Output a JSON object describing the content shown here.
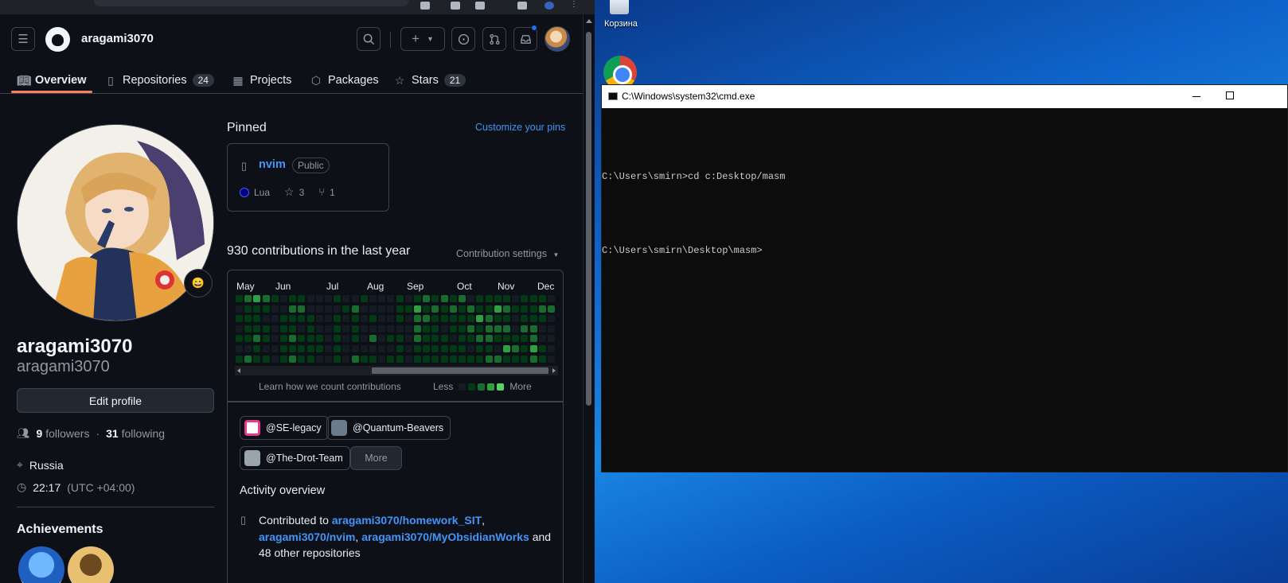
{
  "header": {
    "username": "aragami3070"
  },
  "tabs": [
    {
      "label": "Overview",
      "icon": "book-icon",
      "count": ""
    },
    {
      "label": "Repositories",
      "icon": "repo-icon",
      "count": "24"
    },
    {
      "label": "Projects",
      "icon": "table-icon",
      "count": ""
    },
    {
      "label": "Packages",
      "icon": "package-icon",
      "count": ""
    },
    {
      "label": "Stars",
      "icon": "star-icon",
      "count": "21"
    }
  ],
  "profile": {
    "name": "aragami3070",
    "login": "aragami3070",
    "edit_label": "Edit profile",
    "followers_count": "9",
    "followers_label": "followers",
    "separator": "·",
    "following_count": "31",
    "following_label": "following",
    "location": "Russia",
    "time": "22:17",
    "timezone": "(UTC +04:00)",
    "achievements_title": "Achievements",
    "status_emoji": "😄"
  },
  "pinned": {
    "title": "Pinned",
    "customize_label": "Customize your pins",
    "repo_name": "nvim",
    "visibility": "Public",
    "language": "Lua",
    "stars": "3",
    "forks": "1"
  },
  "contributions": {
    "title": "930 contributions in the last year",
    "settings_label": "Contribution settings",
    "months": [
      "May",
      "Jun",
      "Jul",
      "Aug",
      "Sep",
      "Oct",
      "Nov",
      "Dec"
    ],
    "learn_label": "Learn how we count contributions",
    "less_label": "Less",
    "more_label": "More",
    "levels_colors": [
      "#151b23",
      "#033a16",
      "#196c2e",
      "#2ea043",
      "#56d364"
    ],
    "weeks": [
      [
        1,
        0,
        1,
        0,
        1,
        0,
        1
      ],
      [
        2,
        1,
        1,
        1,
        1,
        0,
        2
      ],
      [
        3,
        1,
        1,
        1,
        2,
        1,
        1
      ],
      [
        2,
        1,
        0,
        1,
        1,
        0,
        1
      ],
      [
        1,
        0,
        0,
        0,
        0,
        0,
        0
      ],
      [
        0,
        0,
        1,
        1,
        1,
        1,
        1
      ],
      [
        1,
        2,
        1,
        1,
        2,
        1,
        2
      ],
      [
        1,
        2,
        1,
        0,
        1,
        1,
        1
      ],
      [
        0,
        0,
        1,
        1,
        1,
        1,
        1
      ],
      [
        0,
        0,
        0,
        0,
        1,
        1,
        0
      ],
      [
        0,
        0,
        0,
        0,
        0,
        0,
        0
      ],
      [
        1,
        0,
        1,
        1,
        1,
        1,
        1
      ],
      [
        0,
        1,
        0,
        0,
        0,
        0,
        0
      ],
      [
        0,
        2,
        1,
        1,
        1,
        0,
        2
      ],
      [
        1,
        0,
        0,
        0,
        0,
        0,
        1
      ],
      [
        0,
        0,
        1,
        0,
        2,
        0,
        1
      ],
      [
        0,
        0,
        0,
        0,
        0,
        0,
        0
      ],
      [
        0,
        0,
        0,
        0,
        1,
        0,
        1
      ],
      [
        1,
        1,
        1,
        0,
        1,
        1,
        1
      ],
      [
        0,
        1,
        0,
        0,
        0,
        0,
        0
      ],
      [
        1,
        3,
        2,
        2,
        2,
        1,
        1
      ],
      [
        2,
        1,
        2,
        1,
        1,
        1,
        1
      ],
      [
        1,
        2,
        1,
        1,
        1,
        1,
        1
      ],
      [
        2,
        1,
        1,
        0,
        1,
        1,
        1
      ],
      [
        1,
        2,
        1,
        1,
        0,
        1,
        1
      ],
      [
        2,
        1,
        1,
        1,
        1,
        1,
        1
      ],
      [
        0,
        2,
        1,
        2,
        1,
        0,
        1
      ],
      [
        1,
        1,
        3,
        1,
        2,
        1,
        1
      ],
      [
        1,
        1,
        2,
        2,
        2,
        1,
        2
      ],
      [
        1,
        3,
        1,
        2,
        1,
        0,
        2
      ],
      [
        1,
        2,
        1,
        2,
        1,
        3,
        1
      ],
      [
        0,
        1,
        0,
        0,
        1,
        2,
        1
      ],
      [
        1,
        1,
        1,
        2,
        1,
        1,
        1
      ],
      [
        1,
        1,
        1,
        2,
        2,
        3,
        2
      ],
      [
        1,
        2,
        1,
        0,
        0,
        1,
        1
      ],
      [
        0,
        2,
        0,
        0,
        0,
        0,
        0
      ]
    ]
  },
  "orgs": [
    {
      "name": "@SE-legacy",
      "color": "#e9398a"
    },
    {
      "name": "@Quantum-Beavers",
      "color": "#6b7b8c"
    },
    {
      "name": "@The-Drot-Team",
      "color": "#9aa4ae"
    }
  ],
  "orgs_more_label": "More",
  "activity": {
    "title": "Activity overview",
    "prefix": "Contributed to",
    "repo1": "aragami3070/homework_SIT",
    "repo2": "aragami3070/nvim",
    "repo3": "aragami3070/MyObsidianWorks",
    "suffix": "and 48 other repositories"
  },
  "desktop": {
    "recycle_bin_label": "Корзина",
    "cmd_title": "C:\\Windows\\system32\\cmd.exe",
    "cmd_lines": [
      "C:\\Users\\smirn>cd c:Desktop/masm",
      "C:\\Users\\smirn\\Desktop\\masm>"
    ]
  }
}
